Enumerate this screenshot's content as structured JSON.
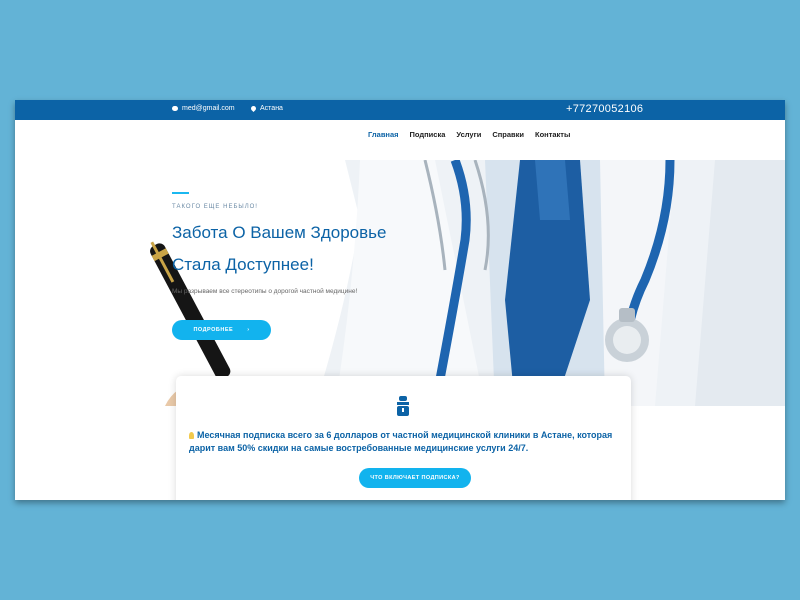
{
  "topbar": {
    "email": "med@gmail.com",
    "city": "Астана",
    "phone": "+77270052106"
  },
  "nav": {
    "items": [
      "Главная",
      "Подписка",
      "Услуги",
      "Справки",
      "Контакты"
    ],
    "active": "Главная"
  },
  "hero": {
    "tagline": "ТАКОГО ЕЩЕ НЕБЫЛО!",
    "title_line1": "Забота О Вашем Здоровье",
    "title_line2": "Стала Доступнее!",
    "subtitle": "Мы разрываем все стереотипы о дорогой частной медицине!",
    "button_label": "ПОДРОБНЕЕ",
    "button_arrow": "›"
  },
  "card": {
    "text": "Месячная подписка всего за 6 долларов от частной медицинской клиники в Астане, которая дарит вам 50% скидки на самые востребованные медицинские услуги 24/7.",
    "button_label": "ЧТО ВКЛЮЧАЕТ ПОДПИСКА?"
  },
  "colors": {
    "background": "#63b3d6",
    "brand_blue": "#0c63a6",
    "accent": "#12b3ee"
  }
}
